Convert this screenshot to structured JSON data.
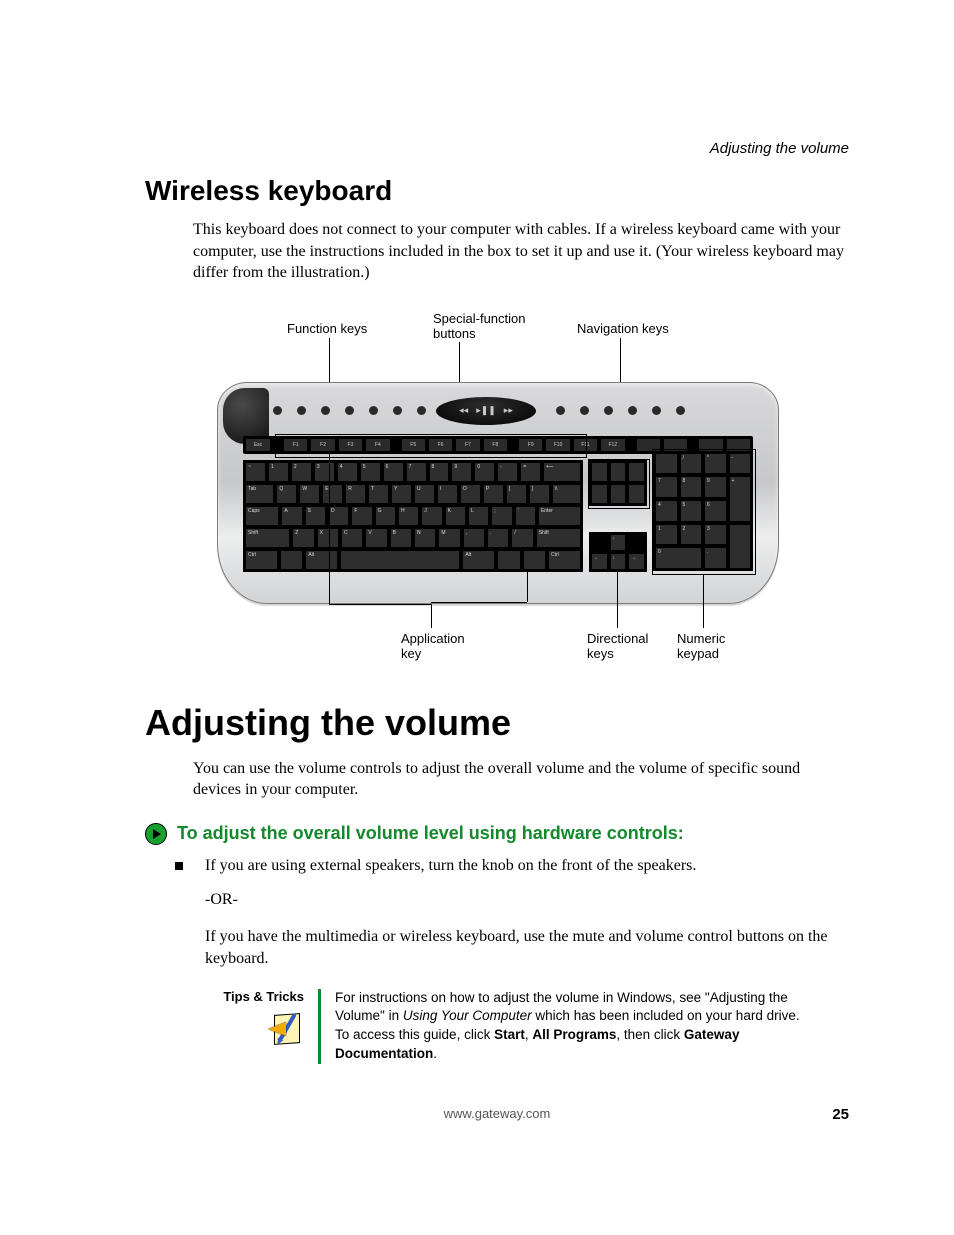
{
  "running_header": "Adjusting the volume",
  "section1": {
    "heading": "Wireless keyboard",
    "body": "This keyboard does not connect to your computer with cables. If a wireless keyboard came with your computer, use the instructions included in the box to set it up and use it. (Your wireless keyboard may differ from the illustration.)"
  },
  "figure": {
    "labels": {
      "function_keys": "Function keys",
      "special_function_buttons_l1": "Special-function",
      "special_function_buttons_l2": "buttons",
      "navigation_keys": "Navigation keys",
      "application_key_l1": "Application",
      "application_key_l2": "key",
      "directional_keys_l1": "Directional",
      "directional_keys_l2": "keys",
      "numeric_keypad_l1": "Numeric",
      "numeric_keypad_l2": "keypad"
    }
  },
  "section2": {
    "heading": "Adjusting the volume",
    "body": "You can use the volume controls to adjust the overall volume and the volume of specific sound devices in your computer."
  },
  "instructions": {
    "heading": "To adjust the overall volume level using hardware controls:",
    "bullet": "If you are using external speakers, turn the knob on the front of the speakers.",
    "or": "-OR-",
    "para": "If you have the multimedia or wireless keyboard, use the mute and volume control buttons on the keyboard."
  },
  "tips": {
    "title": "Tips & Tricks",
    "text_1": "For instructions on how to adjust the volume in Windows, see \"Adjusting the Volume\" in ",
    "text_it": "Using Your Computer",
    "text_2": " which has been included on your hard drive. To access this guide, click ",
    "b1": "Start",
    "text_3": ", ",
    "b2": "All Programs",
    "text_4": ", then click ",
    "b3": "Gateway Documentation",
    "text_5": "."
  },
  "footer": {
    "url": "www.gateway.com",
    "page": "25"
  }
}
